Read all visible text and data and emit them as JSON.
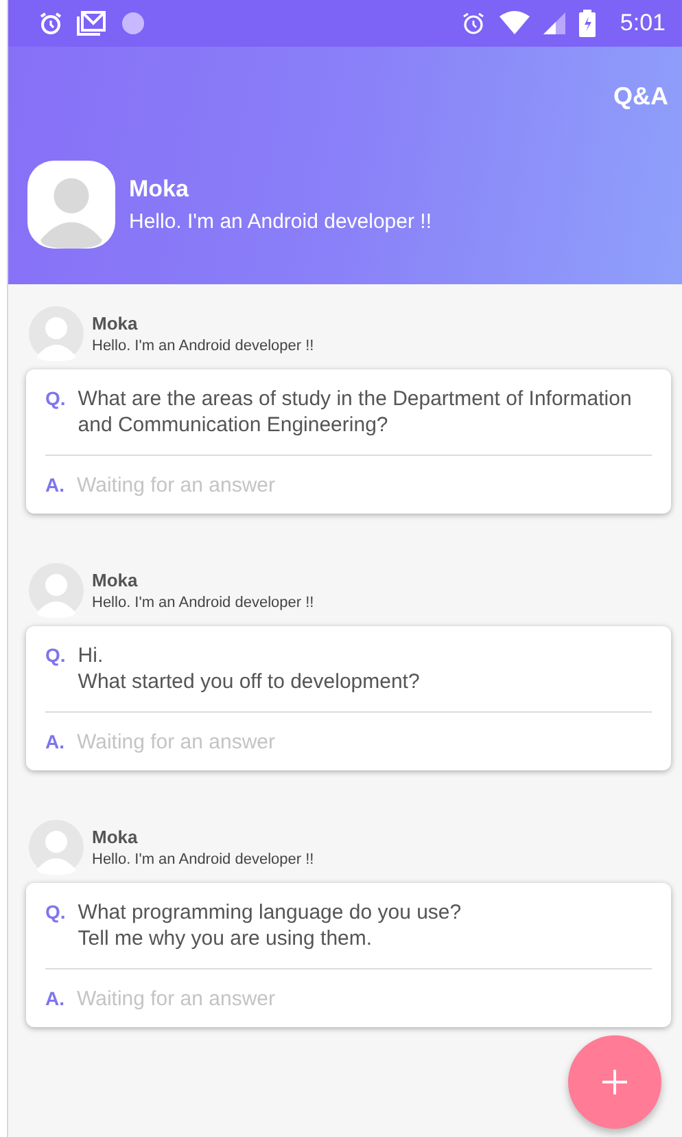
{
  "status_bar": {
    "time": "5:01"
  },
  "header": {
    "title": "Q&A",
    "profile": {
      "name": "Moka",
      "bio": "Hello. I'm an Android developer !!"
    }
  },
  "posts": [
    {
      "author": "Moka",
      "bio": "Hello. I'm an Android developer !!",
      "q_mark": "Q.",
      "question": "What are the areas of study in the Department of Information and Communication Engineering?",
      "a_mark": "A.",
      "answer_placeholder": "Waiting for an answer"
    },
    {
      "author": "Moka",
      "bio": "Hello. I'm an Android developer !!",
      "q_mark": "Q.",
      "question": "Hi.\nWhat started you off to development?",
      "a_mark": "A.",
      "answer_placeholder": "Waiting for an answer"
    },
    {
      "author": "Moka",
      "bio": "Hello. I'm an Android developer !!",
      "q_mark": "Q.",
      "question": "What programming language do you use?\nTell me why you are using them.",
      "a_mark": "A.",
      "answer_placeholder": "Waiting for an answer"
    }
  ]
}
